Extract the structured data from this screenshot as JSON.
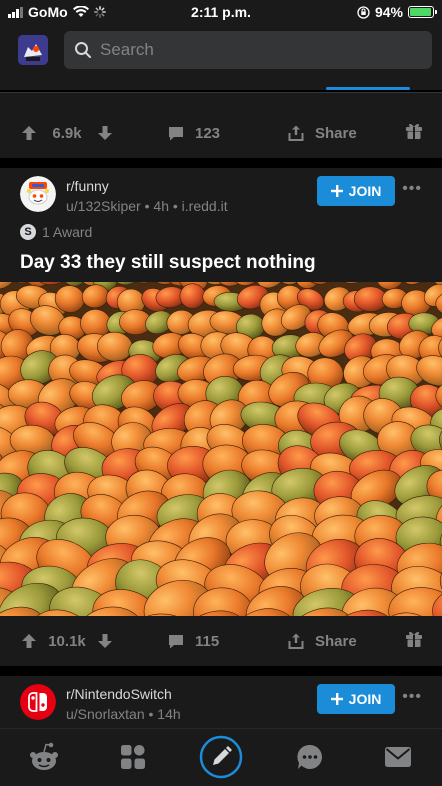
{
  "status_bar": {
    "carrier": "GoMo",
    "time": "2:11 p.m.",
    "battery_percent": "94%",
    "battery_level": 0.94,
    "battery_color": "#4cd964"
  },
  "header": {
    "search_placeholder": "Search",
    "accent_color": "#1b8cd8"
  },
  "previous_post": {
    "upvotes": "6.9k",
    "comments": "123",
    "share_label": "Share"
  },
  "post": {
    "subreddit": "r/funny",
    "author": "u/132Skiper",
    "age": "4h",
    "domain": "i.redd.it",
    "join_label": "JOIN",
    "award_text": "1 Award",
    "title": "Day 33 they still suspect nothing",
    "image_icon": "mango-pile-photo",
    "upvotes": "10.1k",
    "comments": "115",
    "share_label": "Share"
  },
  "next_post": {
    "subreddit": "r/NintendoSwitch",
    "author": "u/Snorlaxtan",
    "age": "14h",
    "join_label": "JOIN",
    "avatar_color": "#e60012"
  },
  "bottom_nav": {
    "items": [
      "home-icon",
      "communities-icon",
      "create-post-icon",
      "chat-icon",
      "inbox-icon"
    ],
    "active": "create-post-icon"
  }
}
